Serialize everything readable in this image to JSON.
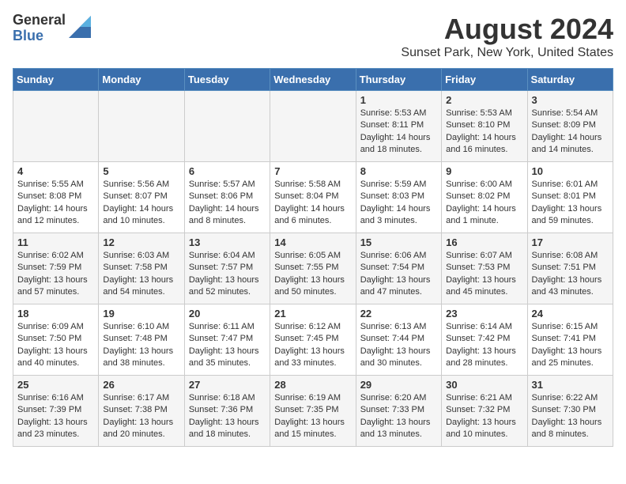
{
  "header": {
    "logo_general": "General",
    "logo_blue": "Blue",
    "title": "August 2024",
    "location": "Sunset Park, New York, United States"
  },
  "days_of_week": [
    "Sunday",
    "Monday",
    "Tuesday",
    "Wednesday",
    "Thursday",
    "Friday",
    "Saturday"
  ],
  "weeks": [
    [
      {
        "day": "",
        "info": ""
      },
      {
        "day": "",
        "info": ""
      },
      {
        "day": "",
        "info": ""
      },
      {
        "day": "",
        "info": ""
      },
      {
        "day": "1",
        "info": "Sunrise: 5:53 AM\nSunset: 8:11 PM\nDaylight: 14 hours\nand 18 minutes."
      },
      {
        "day": "2",
        "info": "Sunrise: 5:53 AM\nSunset: 8:10 PM\nDaylight: 14 hours\nand 16 minutes."
      },
      {
        "day": "3",
        "info": "Sunrise: 5:54 AM\nSunset: 8:09 PM\nDaylight: 14 hours\nand 14 minutes."
      }
    ],
    [
      {
        "day": "4",
        "info": "Sunrise: 5:55 AM\nSunset: 8:08 PM\nDaylight: 14 hours\nand 12 minutes."
      },
      {
        "day": "5",
        "info": "Sunrise: 5:56 AM\nSunset: 8:07 PM\nDaylight: 14 hours\nand 10 minutes."
      },
      {
        "day": "6",
        "info": "Sunrise: 5:57 AM\nSunset: 8:06 PM\nDaylight: 14 hours\nand 8 minutes."
      },
      {
        "day": "7",
        "info": "Sunrise: 5:58 AM\nSunset: 8:04 PM\nDaylight: 14 hours\nand 6 minutes."
      },
      {
        "day": "8",
        "info": "Sunrise: 5:59 AM\nSunset: 8:03 PM\nDaylight: 14 hours\nand 3 minutes."
      },
      {
        "day": "9",
        "info": "Sunrise: 6:00 AM\nSunset: 8:02 PM\nDaylight: 14 hours\nand 1 minute."
      },
      {
        "day": "10",
        "info": "Sunrise: 6:01 AM\nSunset: 8:01 PM\nDaylight: 13 hours\nand 59 minutes."
      }
    ],
    [
      {
        "day": "11",
        "info": "Sunrise: 6:02 AM\nSunset: 7:59 PM\nDaylight: 13 hours\nand 57 minutes."
      },
      {
        "day": "12",
        "info": "Sunrise: 6:03 AM\nSunset: 7:58 PM\nDaylight: 13 hours\nand 54 minutes."
      },
      {
        "day": "13",
        "info": "Sunrise: 6:04 AM\nSunset: 7:57 PM\nDaylight: 13 hours\nand 52 minutes."
      },
      {
        "day": "14",
        "info": "Sunrise: 6:05 AM\nSunset: 7:55 PM\nDaylight: 13 hours\nand 50 minutes."
      },
      {
        "day": "15",
        "info": "Sunrise: 6:06 AM\nSunset: 7:54 PM\nDaylight: 13 hours\nand 47 minutes."
      },
      {
        "day": "16",
        "info": "Sunrise: 6:07 AM\nSunset: 7:53 PM\nDaylight: 13 hours\nand 45 minutes."
      },
      {
        "day": "17",
        "info": "Sunrise: 6:08 AM\nSunset: 7:51 PM\nDaylight: 13 hours\nand 43 minutes."
      }
    ],
    [
      {
        "day": "18",
        "info": "Sunrise: 6:09 AM\nSunset: 7:50 PM\nDaylight: 13 hours\nand 40 minutes."
      },
      {
        "day": "19",
        "info": "Sunrise: 6:10 AM\nSunset: 7:48 PM\nDaylight: 13 hours\nand 38 minutes."
      },
      {
        "day": "20",
        "info": "Sunrise: 6:11 AM\nSunset: 7:47 PM\nDaylight: 13 hours\nand 35 minutes."
      },
      {
        "day": "21",
        "info": "Sunrise: 6:12 AM\nSunset: 7:45 PM\nDaylight: 13 hours\nand 33 minutes."
      },
      {
        "day": "22",
        "info": "Sunrise: 6:13 AM\nSunset: 7:44 PM\nDaylight: 13 hours\nand 30 minutes."
      },
      {
        "day": "23",
        "info": "Sunrise: 6:14 AM\nSunset: 7:42 PM\nDaylight: 13 hours\nand 28 minutes."
      },
      {
        "day": "24",
        "info": "Sunrise: 6:15 AM\nSunset: 7:41 PM\nDaylight: 13 hours\nand 25 minutes."
      }
    ],
    [
      {
        "day": "25",
        "info": "Sunrise: 6:16 AM\nSunset: 7:39 PM\nDaylight: 13 hours\nand 23 minutes."
      },
      {
        "day": "26",
        "info": "Sunrise: 6:17 AM\nSunset: 7:38 PM\nDaylight: 13 hours\nand 20 minutes."
      },
      {
        "day": "27",
        "info": "Sunrise: 6:18 AM\nSunset: 7:36 PM\nDaylight: 13 hours\nand 18 minutes."
      },
      {
        "day": "28",
        "info": "Sunrise: 6:19 AM\nSunset: 7:35 PM\nDaylight: 13 hours\nand 15 minutes."
      },
      {
        "day": "29",
        "info": "Sunrise: 6:20 AM\nSunset: 7:33 PM\nDaylight: 13 hours\nand 13 minutes."
      },
      {
        "day": "30",
        "info": "Sunrise: 6:21 AM\nSunset: 7:32 PM\nDaylight: 13 hours\nand 10 minutes."
      },
      {
        "day": "31",
        "info": "Sunrise: 6:22 AM\nSunset: 7:30 PM\nDaylight: 13 hours\nand 8 minutes."
      }
    ]
  ]
}
